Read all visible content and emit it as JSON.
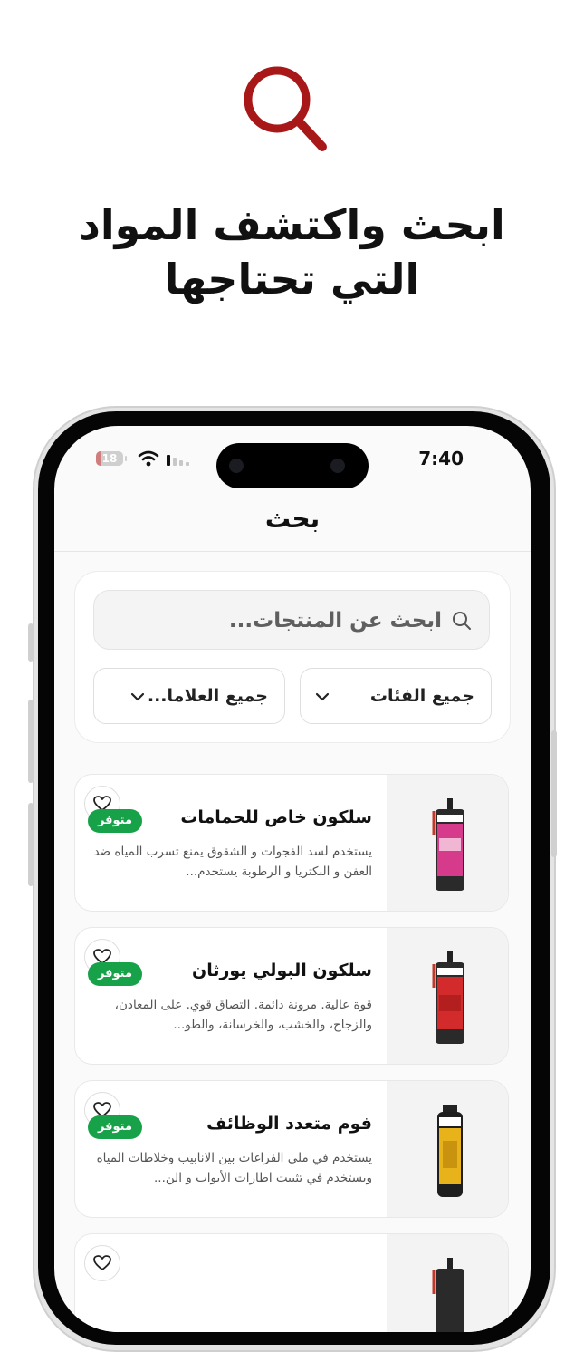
{
  "headline": {
    "line1": "ابحث واكتشف المواد",
    "line2": "التي تحتاجها"
  },
  "status_bar": {
    "time": "7:40",
    "battery": "18"
  },
  "nav": {
    "title": "بحث"
  },
  "search": {
    "placeholder": "ابحث عن المنتجات..."
  },
  "filters": {
    "categories": "جميع الفئات",
    "brands": "جميع العلاما..."
  },
  "products": [
    {
      "title": "سلكون خاص للحمامات",
      "description": "يستخدم لسد الفجوات و الشقوق يمنع تسرب المياه ضد العفن و البكتريا و الرطوبة يستخدم...",
      "badge": "متوفر",
      "tube_color": "#d63a8a"
    },
    {
      "title": "سلكون البولي يورثان",
      "description": "قوة عالية. مرونة دائمة. التصاق قوي. على المعادن، والزجاج، والخشب، والخرسانة، والطو...",
      "badge": "متوفر",
      "tube_color": "#d32b2b"
    },
    {
      "title": "فوم متعدد الوظائف",
      "description": "يستخدم في ملى الفراغات بين الانابيب وخلاطات المياه ويستخدم في تثبيت اطارات الأبواب و الن...",
      "badge": "متوفر",
      "tube_color": "#e8b21a"
    }
  ],
  "colors": {
    "accent": "#a81818",
    "available_badge": "#17a24a"
  }
}
